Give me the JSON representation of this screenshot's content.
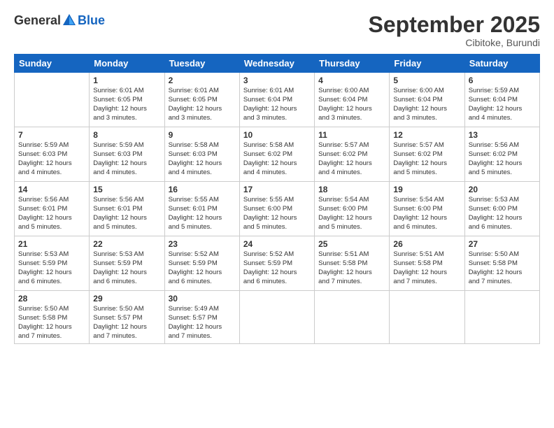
{
  "logo": {
    "general": "General",
    "blue": "Blue"
  },
  "header": {
    "month": "September 2025",
    "location": "Cibitoke, Burundi"
  },
  "days": [
    "Sunday",
    "Monday",
    "Tuesday",
    "Wednesday",
    "Thursday",
    "Friday",
    "Saturday"
  ],
  "weeks": [
    [
      {
        "num": "",
        "info": ""
      },
      {
        "num": "1",
        "info": "Sunrise: 6:01 AM\nSunset: 6:05 PM\nDaylight: 12 hours\nand 3 minutes."
      },
      {
        "num": "2",
        "info": "Sunrise: 6:01 AM\nSunset: 6:05 PM\nDaylight: 12 hours\nand 3 minutes."
      },
      {
        "num": "3",
        "info": "Sunrise: 6:01 AM\nSunset: 6:04 PM\nDaylight: 12 hours\nand 3 minutes."
      },
      {
        "num": "4",
        "info": "Sunrise: 6:00 AM\nSunset: 6:04 PM\nDaylight: 12 hours\nand 3 minutes."
      },
      {
        "num": "5",
        "info": "Sunrise: 6:00 AM\nSunset: 6:04 PM\nDaylight: 12 hours\nand 3 minutes."
      },
      {
        "num": "6",
        "info": "Sunrise: 5:59 AM\nSunset: 6:04 PM\nDaylight: 12 hours\nand 4 minutes."
      }
    ],
    [
      {
        "num": "7",
        "info": "Sunrise: 5:59 AM\nSunset: 6:03 PM\nDaylight: 12 hours\nand 4 minutes."
      },
      {
        "num": "8",
        "info": "Sunrise: 5:59 AM\nSunset: 6:03 PM\nDaylight: 12 hours\nand 4 minutes."
      },
      {
        "num": "9",
        "info": "Sunrise: 5:58 AM\nSunset: 6:03 PM\nDaylight: 12 hours\nand 4 minutes."
      },
      {
        "num": "10",
        "info": "Sunrise: 5:58 AM\nSunset: 6:02 PM\nDaylight: 12 hours\nand 4 minutes."
      },
      {
        "num": "11",
        "info": "Sunrise: 5:57 AM\nSunset: 6:02 PM\nDaylight: 12 hours\nand 4 minutes."
      },
      {
        "num": "12",
        "info": "Sunrise: 5:57 AM\nSunset: 6:02 PM\nDaylight: 12 hours\nand 5 minutes."
      },
      {
        "num": "13",
        "info": "Sunrise: 5:56 AM\nSunset: 6:02 PM\nDaylight: 12 hours\nand 5 minutes."
      }
    ],
    [
      {
        "num": "14",
        "info": "Sunrise: 5:56 AM\nSunset: 6:01 PM\nDaylight: 12 hours\nand 5 minutes."
      },
      {
        "num": "15",
        "info": "Sunrise: 5:56 AM\nSunset: 6:01 PM\nDaylight: 12 hours\nand 5 minutes."
      },
      {
        "num": "16",
        "info": "Sunrise: 5:55 AM\nSunset: 6:01 PM\nDaylight: 12 hours\nand 5 minutes."
      },
      {
        "num": "17",
        "info": "Sunrise: 5:55 AM\nSunset: 6:00 PM\nDaylight: 12 hours\nand 5 minutes."
      },
      {
        "num": "18",
        "info": "Sunrise: 5:54 AM\nSunset: 6:00 PM\nDaylight: 12 hours\nand 5 minutes."
      },
      {
        "num": "19",
        "info": "Sunrise: 5:54 AM\nSunset: 6:00 PM\nDaylight: 12 hours\nand 6 minutes."
      },
      {
        "num": "20",
        "info": "Sunrise: 5:53 AM\nSunset: 6:00 PM\nDaylight: 12 hours\nand 6 minutes."
      }
    ],
    [
      {
        "num": "21",
        "info": "Sunrise: 5:53 AM\nSunset: 5:59 PM\nDaylight: 12 hours\nand 6 minutes."
      },
      {
        "num": "22",
        "info": "Sunrise: 5:53 AM\nSunset: 5:59 PM\nDaylight: 12 hours\nand 6 minutes."
      },
      {
        "num": "23",
        "info": "Sunrise: 5:52 AM\nSunset: 5:59 PM\nDaylight: 12 hours\nand 6 minutes."
      },
      {
        "num": "24",
        "info": "Sunrise: 5:52 AM\nSunset: 5:59 PM\nDaylight: 12 hours\nand 6 minutes."
      },
      {
        "num": "25",
        "info": "Sunrise: 5:51 AM\nSunset: 5:58 PM\nDaylight: 12 hours\nand 7 minutes."
      },
      {
        "num": "26",
        "info": "Sunrise: 5:51 AM\nSunset: 5:58 PM\nDaylight: 12 hours\nand 7 minutes."
      },
      {
        "num": "27",
        "info": "Sunrise: 5:50 AM\nSunset: 5:58 PM\nDaylight: 12 hours\nand 7 minutes."
      }
    ],
    [
      {
        "num": "28",
        "info": "Sunrise: 5:50 AM\nSunset: 5:58 PM\nDaylight: 12 hours\nand 7 minutes."
      },
      {
        "num": "29",
        "info": "Sunrise: 5:50 AM\nSunset: 5:57 PM\nDaylight: 12 hours\nand 7 minutes."
      },
      {
        "num": "30",
        "info": "Sunrise: 5:49 AM\nSunset: 5:57 PM\nDaylight: 12 hours\nand 7 minutes."
      },
      {
        "num": "",
        "info": ""
      },
      {
        "num": "",
        "info": ""
      },
      {
        "num": "",
        "info": ""
      },
      {
        "num": "",
        "info": ""
      }
    ]
  ]
}
